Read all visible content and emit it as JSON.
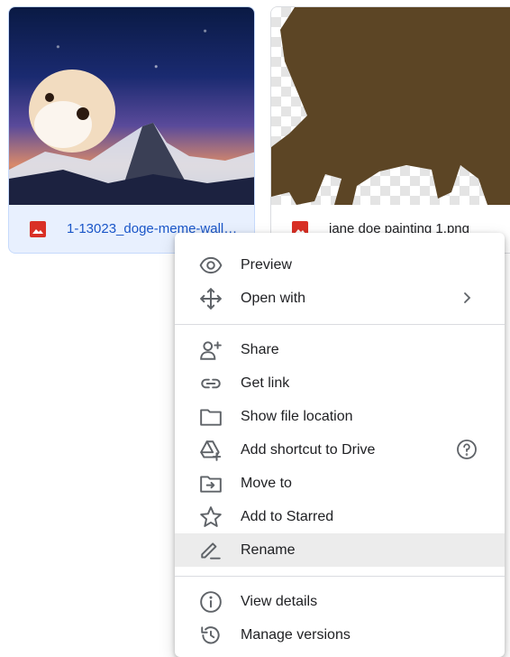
{
  "files": [
    {
      "name": "1-13023_doge-meme-wallp...",
      "icon": "image-file-icon",
      "selected": true
    },
    {
      "name": "jane doe painting 1.png",
      "icon": "image-file-icon",
      "selected": false
    }
  ],
  "context_menu": {
    "groups": [
      [
        {
          "label": "Preview",
          "icon": "eye-icon"
        },
        {
          "label": "Open with",
          "icon": "move-arrows-icon",
          "has_submenu": true
        }
      ],
      [
        {
          "label": "Share",
          "icon": "add-person-icon"
        },
        {
          "label": "Get link",
          "icon": "link-icon"
        },
        {
          "label": "Show file location",
          "icon": "folder-icon"
        },
        {
          "label": "Add shortcut to Drive",
          "icon": "drive-shortcut-icon",
          "has_help": true
        },
        {
          "label": "Move to",
          "icon": "move-to-folder-icon"
        },
        {
          "label": "Add to Starred",
          "icon": "star-icon"
        },
        {
          "label": "Rename",
          "icon": "pencil-icon",
          "highlighted": true
        }
      ],
      [
        {
          "label": "View details",
          "icon": "info-icon"
        },
        {
          "label": "Manage versions",
          "icon": "history-icon"
        }
      ]
    ]
  },
  "colors": {
    "accent": "#1a56c8",
    "file_icon_red": "#d93025",
    "selected_bg": "#e8f0fe",
    "menu_highlight": "#ececec"
  }
}
